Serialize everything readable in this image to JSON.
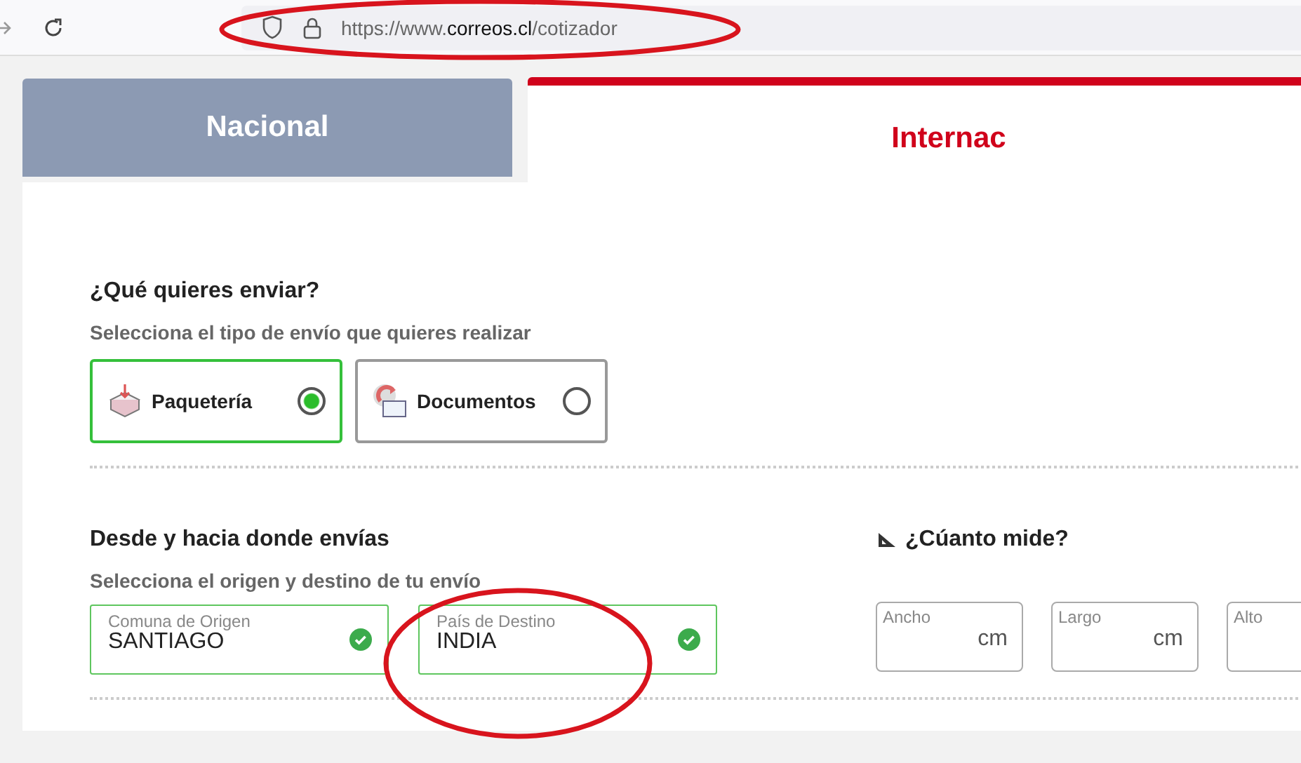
{
  "browser": {
    "url_prefix": "https://www.",
    "url_domain": "correos.cl",
    "url_path": "/cotizador"
  },
  "tabs": [
    {
      "label": "Nacional",
      "selected": false
    },
    {
      "label": "Internac",
      "selected": true
    }
  ],
  "shipment_type": {
    "title": "¿Qué quieres enviar?",
    "subtitle": "Selecciona el tipo de envío que quieres realizar",
    "options": [
      {
        "kind": "package",
        "label": "Paquetería",
        "selected": true
      },
      {
        "kind": "document",
        "label": "Documentos",
        "selected": false
      }
    ]
  },
  "route": {
    "title": "Desde y hacia donde envías",
    "subtitle": "Selecciona el origen y destino de tu envío",
    "fields": [
      {
        "label": "Comuna de Origen",
        "value": "SANTIAGO",
        "valid": true
      },
      {
        "label": "País de Destino",
        "value": "INDIA",
        "valid": true
      }
    ]
  },
  "size": {
    "title": "¿Cúanto mide?",
    "fields": [
      {
        "label": "Ancho",
        "unit": "cm"
      },
      {
        "label": "Largo",
        "unit": "cm"
      },
      {
        "label": "Alto"
      }
    ]
  }
}
